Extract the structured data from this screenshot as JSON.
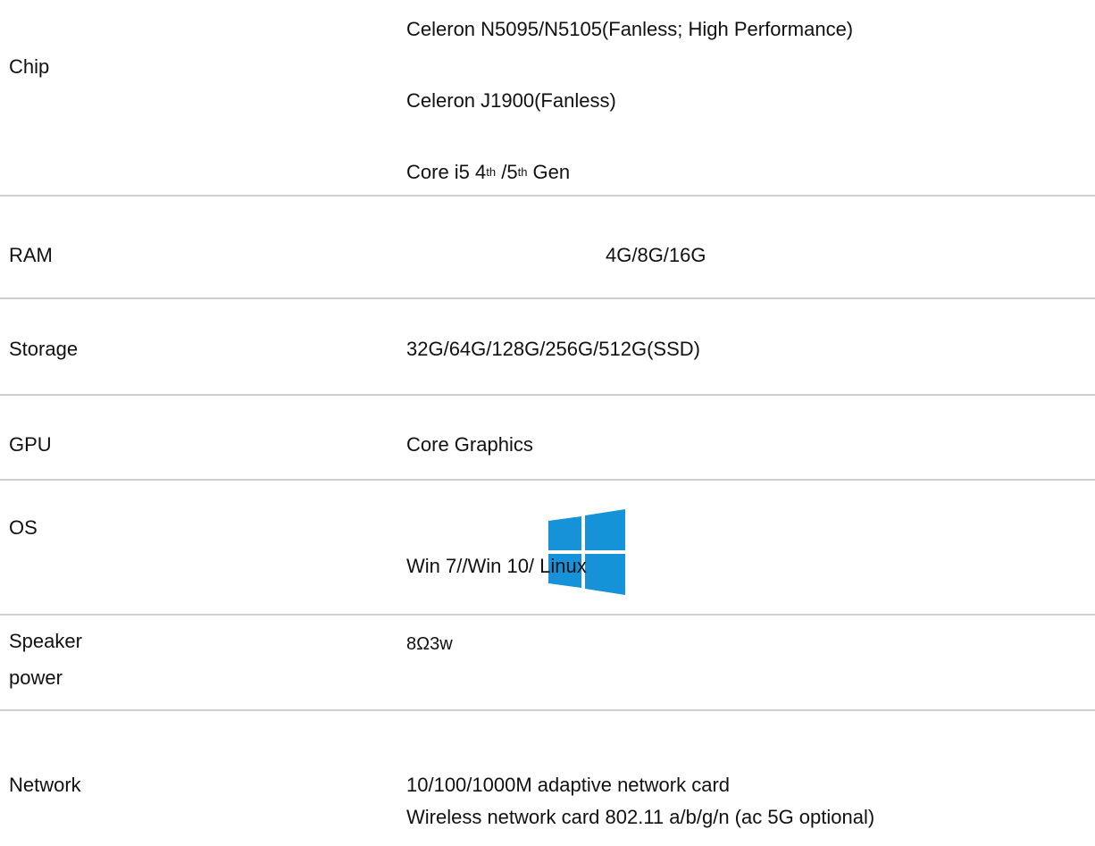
{
  "specs": {
    "chip": {
      "label": "Chip",
      "values": [
        "Celeron N5095/N5105(Fanless; High Performance)",
        "Celeron J1900(Fanless)"
      ],
      "core": {
        "prefix": "Core i5 4",
        "sup1": "th",
        "middle": " /5",
        "sup2": "th",
        "suffix": " Gen"
      }
    },
    "ram": {
      "label": "RAM",
      "value": "4G/8G/16G"
    },
    "storage": {
      "label": "Storage",
      "value": "32G/64G/128G/256G/512G(SSD)"
    },
    "gpu": {
      "label": "GPU",
      "value": "Core Graphics"
    },
    "os": {
      "label": "OS",
      "value": "Win 7//Win 10/ Linux",
      "icon": "windows-logo-icon",
      "icon_color": "#1592d8"
    },
    "speaker": {
      "label_line1": "Speaker",
      "label_line2": "power",
      "value": "8Ω3w"
    },
    "network": {
      "label": "Network",
      "values": [
        "10/100/1000M adaptive network card",
        "Wireless network card 802.11 a/b/g/n (ac 5G optional)"
      ]
    }
  },
  "colors": {
    "divider": "#cfcfcf",
    "text": "#111111",
    "windows_logo": "#1592d8"
  }
}
